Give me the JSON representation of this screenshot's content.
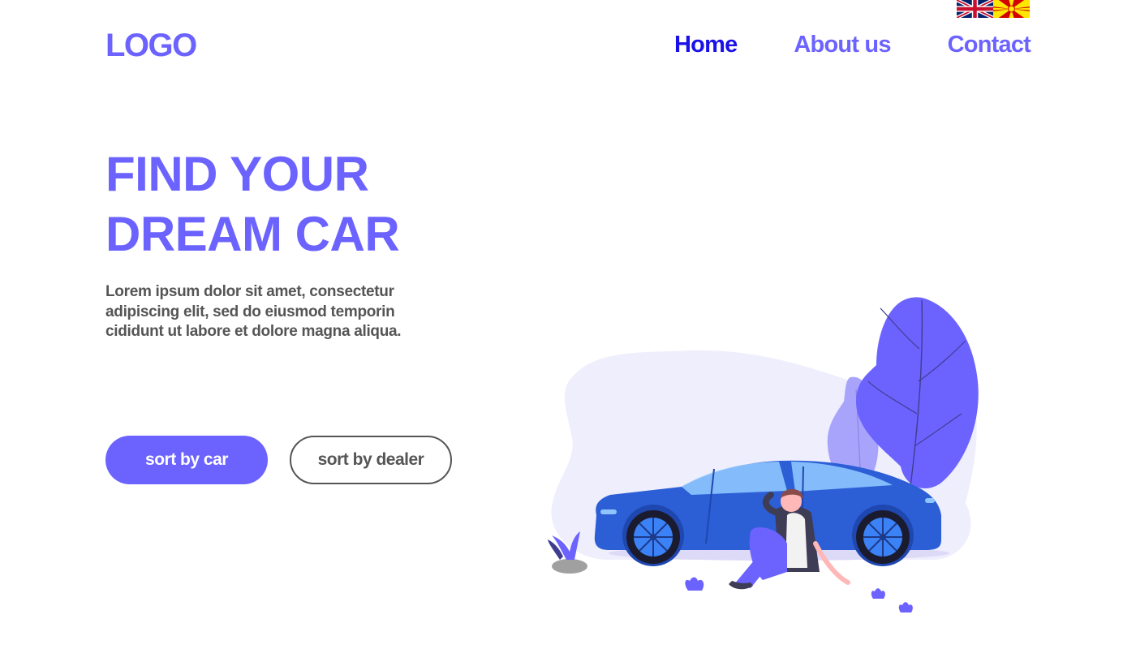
{
  "header": {
    "logo": "LOGO",
    "nav": [
      {
        "label": "Home",
        "active": true
      },
      {
        "label": "About us",
        "active": false
      },
      {
        "label": "Contact",
        "active": false
      }
    ],
    "languages": [
      {
        "icon": "uk-flag-icon",
        "code": "EN"
      },
      {
        "icon": "macedonia-flag-icon",
        "code": "MK"
      }
    ]
  },
  "hero": {
    "title_line1": "FIND YOUR",
    "title_line2": "DREAM CAR",
    "description": "Lorem ipsum dolor sit amet, consectetur adipiscing elit, sed do eiusmod temporin cididunt ut labore et dolore magna aliqua.",
    "buttons": {
      "primary": "sort by car",
      "secondary": "sort by dealer"
    }
  },
  "colors": {
    "accent": "#6c63ff",
    "nav_active": "#1a10e8",
    "text_gray": "#555555",
    "car_blue": "#2c5fd6",
    "blob_bg": "#efeefc"
  }
}
